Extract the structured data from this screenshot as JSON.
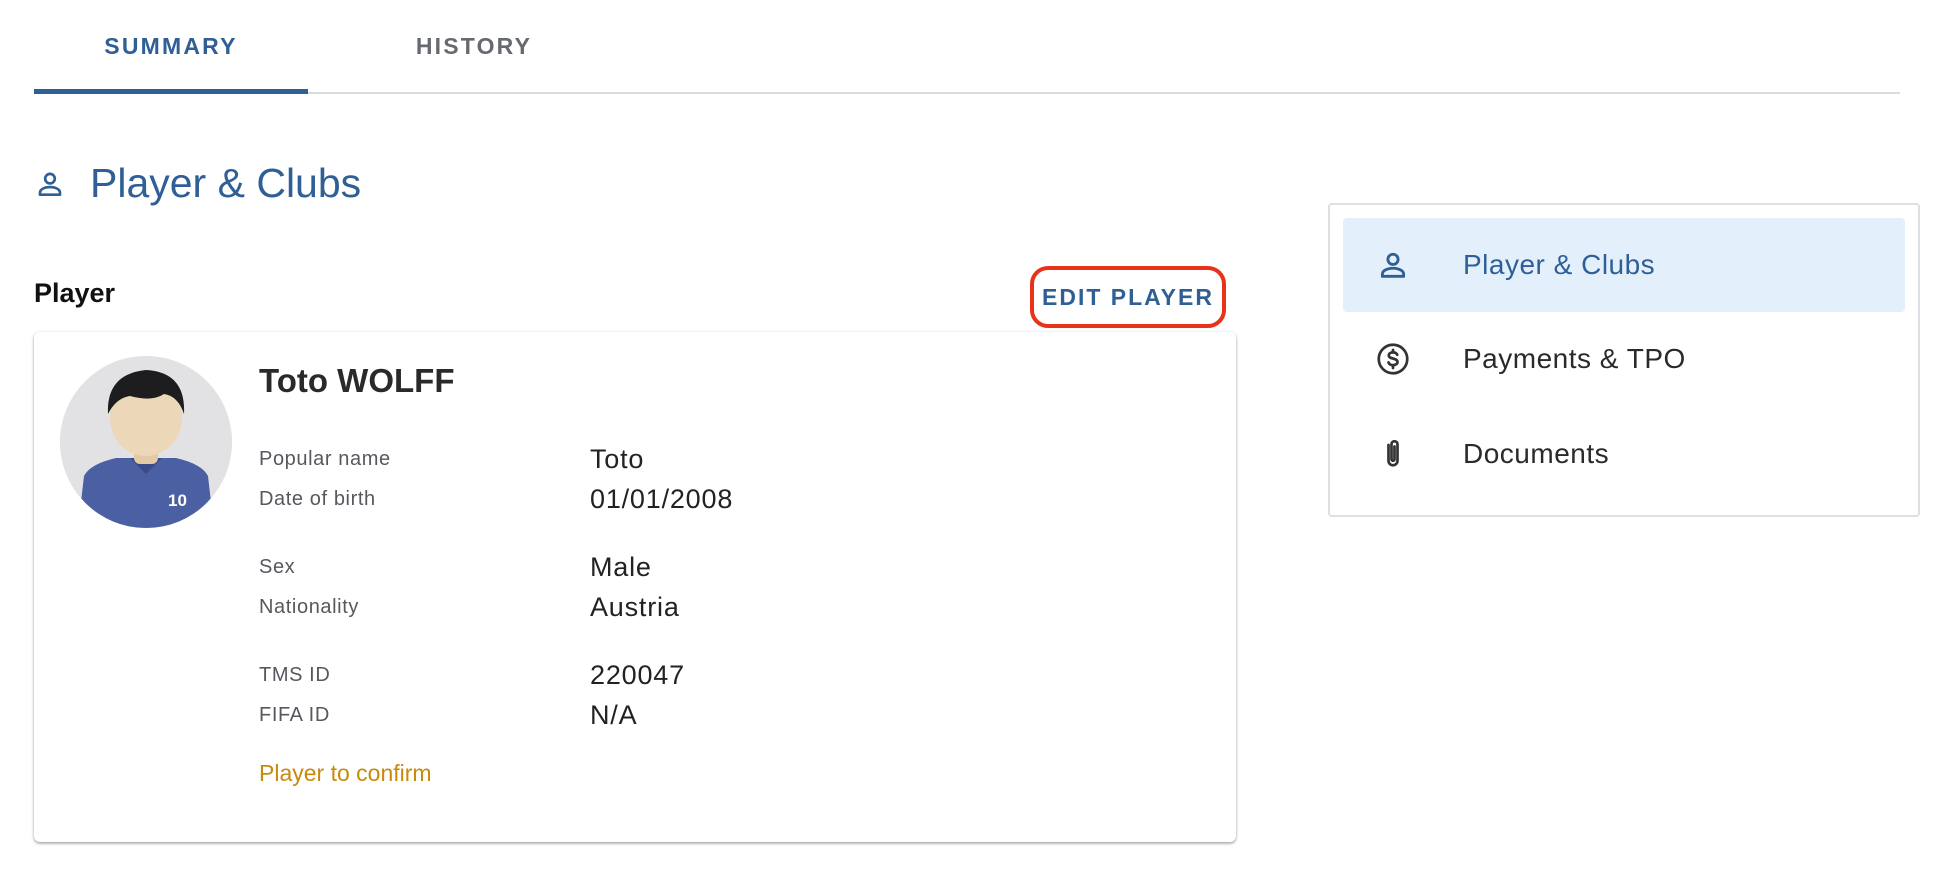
{
  "tabs": [
    {
      "label": "SUMMARY",
      "active": true
    },
    {
      "label": "HISTORY",
      "active": false
    }
  ],
  "section": {
    "title": "Player & Clubs",
    "icon": "person-icon"
  },
  "player_section": {
    "label": "Player",
    "edit_button": "EDIT PLAYER"
  },
  "player": {
    "name": "Toto WOLFF",
    "jersey_number": "10",
    "fields": [
      {
        "label": "Popular name",
        "value": "Toto"
      },
      {
        "label": "Date of birth",
        "value": "01/01/2008"
      },
      {
        "label": "Sex",
        "value": "Male"
      },
      {
        "label": "Nationality",
        "value": "Austria"
      },
      {
        "label": "TMS ID",
        "value": "220047"
      },
      {
        "label": "FIFA ID",
        "value": "N/A"
      }
    ],
    "status": "Player to confirm"
  },
  "sidenav": {
    "items": [
      {
        "label": "Player & Clubs",
        "icon": "person-icon",
        "active": true
      },
      {
        "label": "Payments & TPO",
        "icon": "dollar-circle-icon",
        "active": false
      },
      {
        "label": "Documents",
        "icon": "paperclip-icon",
        "active": false
      }
    ]
  },
  "colors": {
    "primary": "#2f5f95",
    "highlight": "#e3f0fb",
    "status": "#c98a0c",
    "edit_outline": "#e8321a"
  }
}
